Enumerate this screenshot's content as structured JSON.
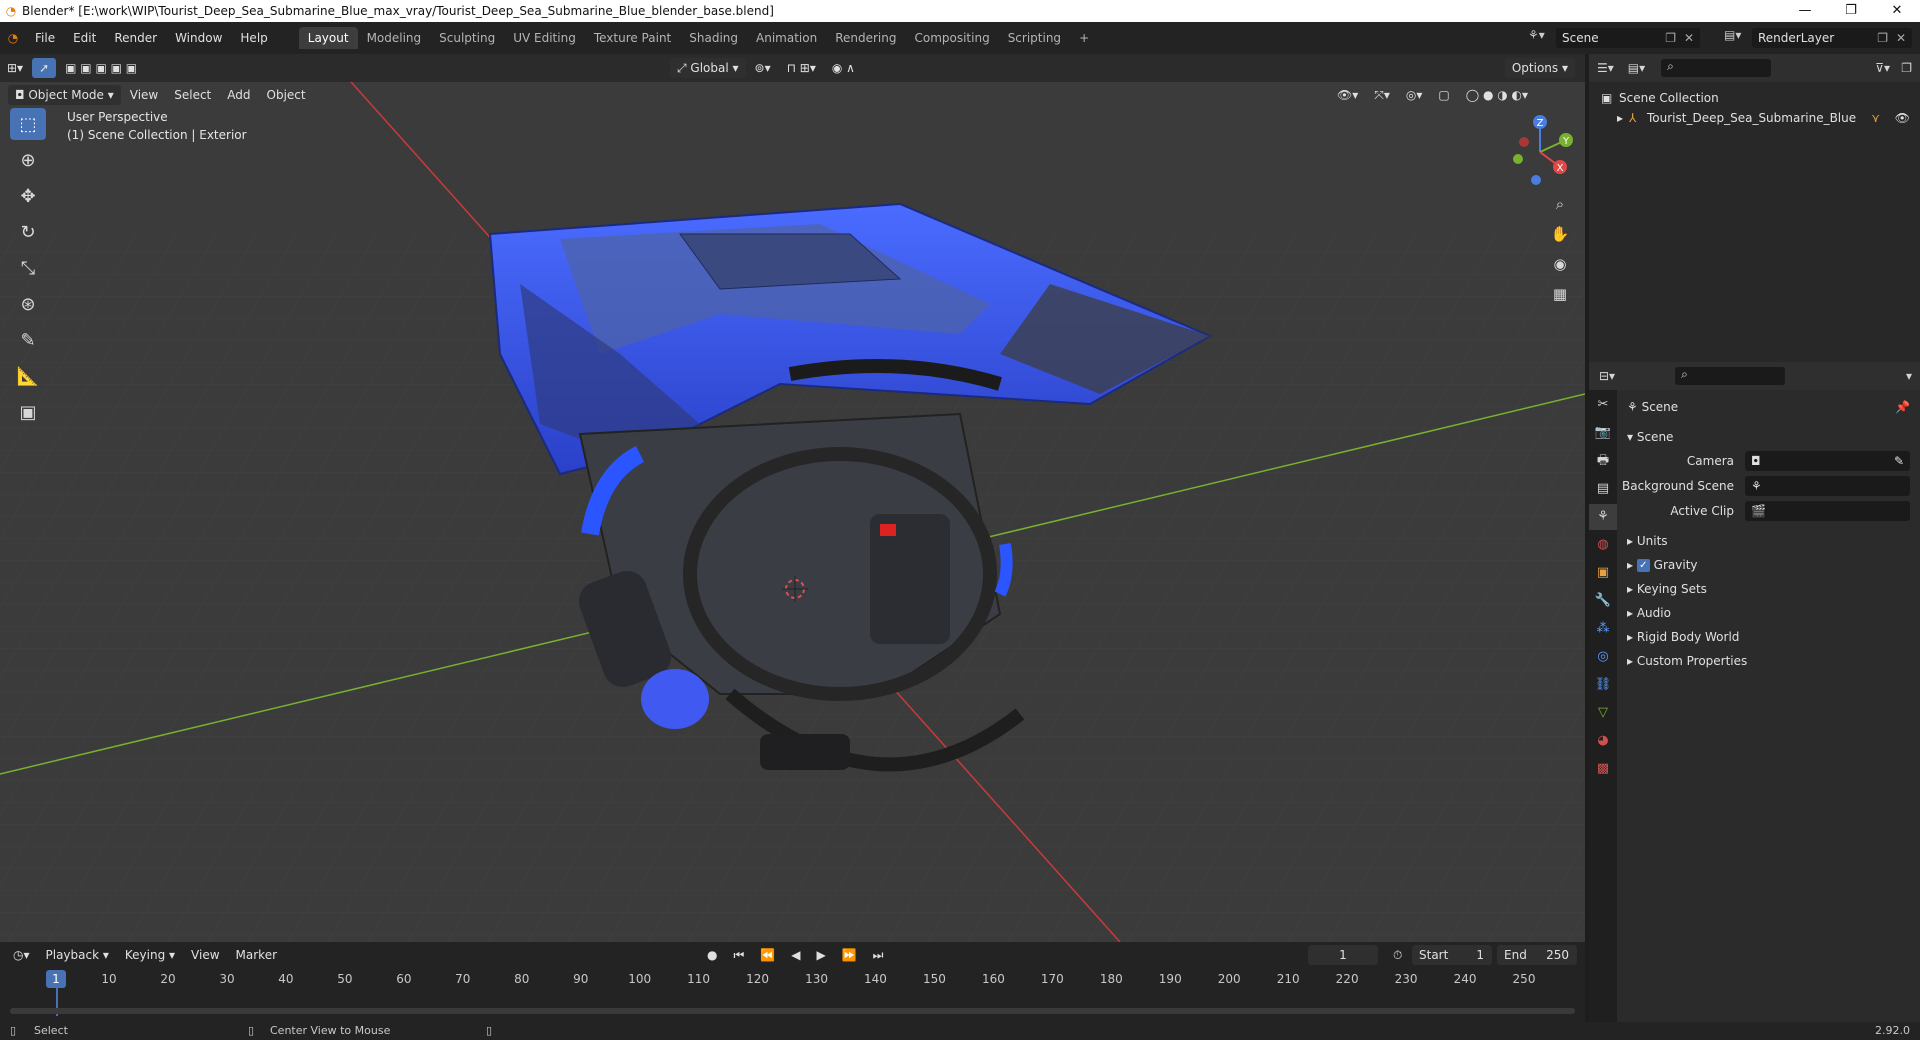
{
  "window": {
    "title": "Blender* [E:\\work\\WIP\\Tourist_Deep_Sea_Submarine_Blue_max_vray/Tourist_Deep_Sea_Submarine_Blue_blender_base.blend]",
    "controls": [
      "—",
      "❐",
      "✕"
    ]
  },
  "menu": [
    "File",
    "Edit",
    "Render",
    "Window",
    "Help"
  ],
  "workspaces": [
    "Layout",
    "Modeling",
    "Sculpting",
    "UV Editing",
    "Texture Paint",
    "Shading",
    "Animation",
    "Rendering",
    "Compositing",
    "Scripting"
  ],
  "workspace_add": "+",
  "scene_selector": "Scene",
  "renderlayer_selector": "RenderLayer",
  "viewport": {
    "transform_orientation": "Global",
    "options_label": "Options",
    "mode": "Object Mode",
    "menus": [
      "View",
      "Select",
      "Add",
      "Object"
    ],
    "perspective_label": "User Perspective",
    "collection_label": "(1) Scene Collection | Exterior",
    "gizmo_axes": {
      "z": "Z",
      "y": "Y",
      "x": "X"
    }
  },
  "outliner": {
    "collection": "Scene Collection",
    "object": "Tourist_Deep_Sea_Submarine_Blue"
  },
  "properties": {
    "context": "Scene",
    "section": "Scene",
    "camera_label": "Camera",
    "background_scene_label": "Background Scene",
    "active_clip_label": "Active Clip",
    "panels": [
      "Units",
      "Gravity",
      "Keying Sets",
      "Audio",
      "Rigid Body World",
      "Custom Properties"
    ],
    "gravity_checked": true
  },
  "timeline": {
    "menus": [
      "Playback",
      "Keying",
      "View",
      "Marker"
    ],
    "current_frame": "1",
    "start_label": "Start",
    "start_value": "1",
    "end_label": "End",
    "end_value": "250",
    "ruler": [
      "1",
      "10",
      "20",
      "30",
      "40",
      "50",
      "60",
      "70",
      "80",
      "90",
      "100",
      "110",
      "120",
      "130",
      "140",
      "150",
      "160",
      "170",
      "180",
      "190",
      "200",
      "210",
      "220",
      "230",
      "240",
      "250"
    ]
  },
  "status": {
    "select": "Select",
    "center_view": "Center View to Mouse",
    "version": "2.92.0"
  },
  "colors": {
    "accent": "#4772b3",
    "submarine_blue": "#3b5cf5",
    "axis_x": "#c93a3a",
    "axis_y": "#7ab030"
  }
}
